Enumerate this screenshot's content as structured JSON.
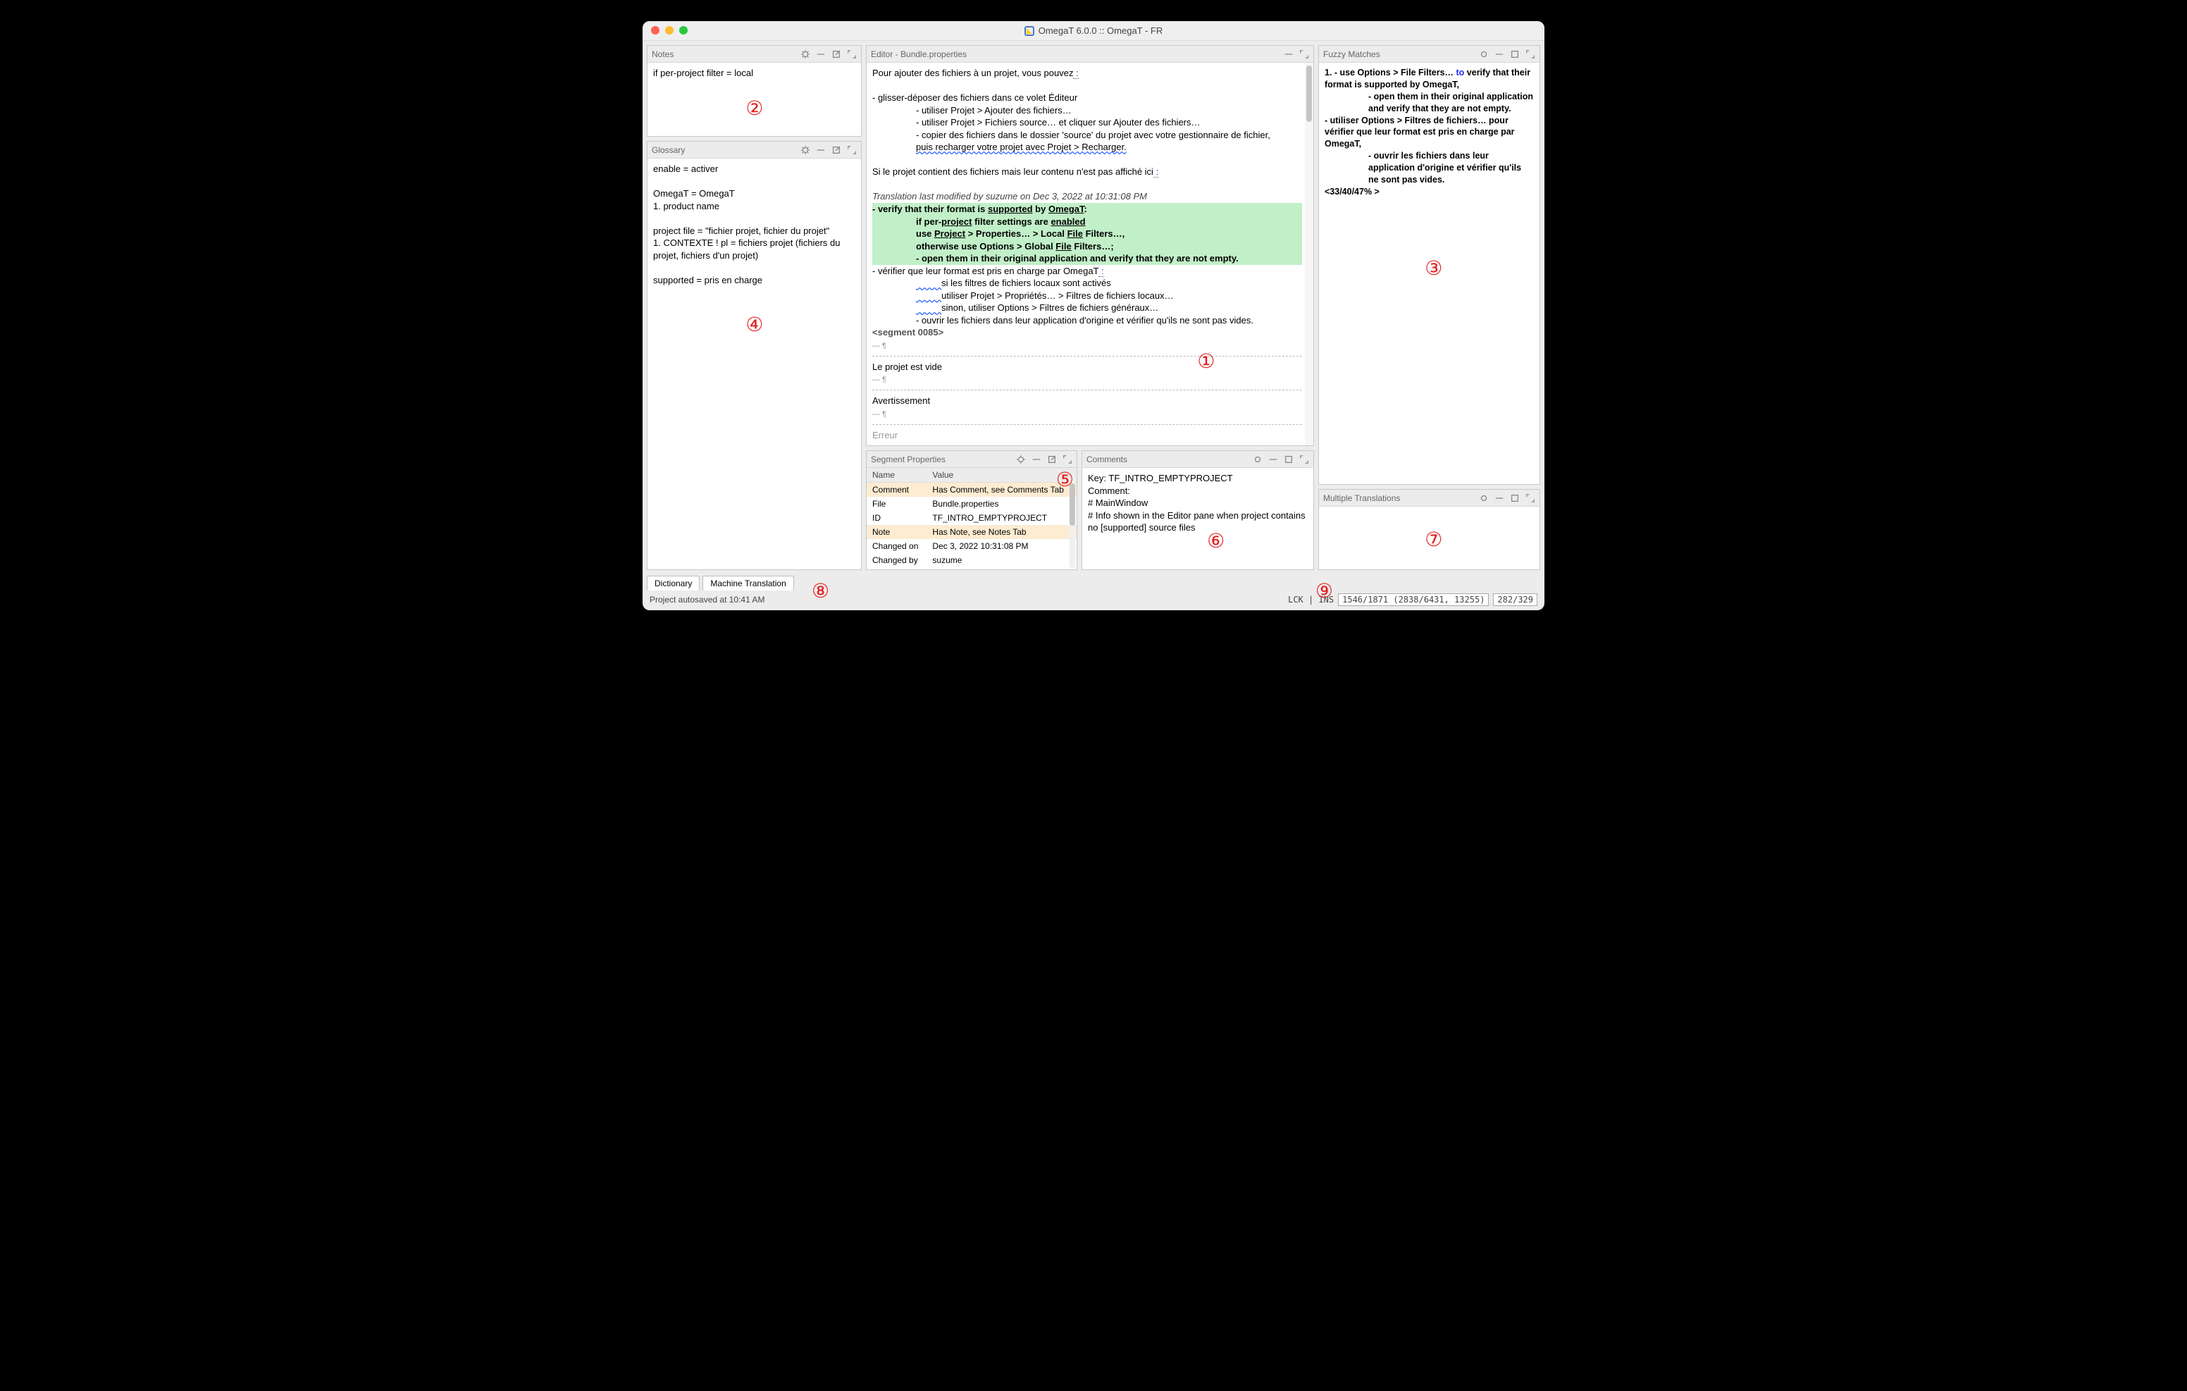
{
  "window": {
    "title": "OmegaT 6.0.0 :: OmegaT - FR"
  },
  "notes": {
    "title": "Notes",
    "text": "if per-project filter = local"
  },
  "glossary": {
    "title": "Glossary",
    "line1": "enable = activer",
    "line2": "OmegaT = OmegaT",
    "line3": "1. product name",
    "line4": "project file = \"fichier projet, fichier du projet\"",
    "line5": "1. CONTEXTE ! pl = fichiers projet (fichiers du projet, fichiers d'un projet)",
    "line6": "supported = pris en charge"
  },
  "editor": {
    "title": "Editor - Bundle.properties",
    "p1": "Pour ajouter des fichiers à un projet, vous pouvez",
    "p1_link": " :",
    "b1": "- glisser-déposer des fichiers dans ce volet Éditeur",
    "b2": "- utiliser Projet > Ajouter des fichiers…",
    "b3": "- utiliser Projet > Fichiers source… et cliquer sur Ajouter des fichiers…",
    "b4": "- copier des fichiers dans le dossier 'source' du projet avec votre gestionnaire de fichier,",
    "b5_pre": "puis recharger votre projet avec Projet > Recharger.",
    "p2": "Si le projet contient des fichiers mais leur contenu n'est pas affiché ici",
    "p2_link": " :",
    "meta": "Translation last modified by suzume on Dec 3, 2022 at 10:31:08 PM",
    "g1_a": "- verify that their format is ",
    "g1_b": "supported",
    "g1_c": " by ",
    "g1_d": "OmegaT",
    "g2_a": "if per-",
    "g2_b": "project",
    "g2_c": " filter settings are ",
    "g2_d": "enabled",
    "g3_a": "use ",
    "g3_b": "Project",
    "g3_c": " > Properties… > Local ",
    "g3_d": "File",
    "g3_e": " Filters…,",
    "g4_a": "otherwise use Options > Global ",
    "g4_b": "File",
    "g4_c": " Filters…;",
    "g5": "- open them in their original application and verify that they are not empty.",
    "f1": "- vérifier que leur format est pris en charge par OmegaT",
    "f1_link": " :",
    "f2": "si les filtres de fichiers locaux sont activés",
    "f3": "utiliser Projet > Propriétés… > Filtres de fichiers locaux…",
    "f4": "sinon, utiliser Options > Filtres de fichiers généraux…",
    "f5": "- ouvrir les fichiers dans leur application d'origine et vérifier qu'ils ne sont pas vides.",
    "segmark": "<segment 0085>",
    "p3": "Le projet est vide",
    "p4": "Avertissement",
    "p5": "Erreur"
  },
  "segprops": {
    "title": "Segment Properties",
    "name": "Name",
    "value": "Value",
    "rows": {
      "r0n": "Comment",
      "r0v": "Has Comment, see Comments Tab",
      "r1n": "File",
      "r1v": "Bundle.properties",
      "r2n": "ID",
      "r2v": "TF_INTRO_EMPTYPROJECT",
      "r3n": "Note",
      "r3v": "Has Note, see Notes Tab",
      "r4n": "Changed on",
      "r4v": "Dec 3, 2022 10:31:08 PM",
      "r5n": "Changed by",
      "r5v": "suzume"
    }
  },
  "comments": {
    "title": "Comments",
    "l1": "Key: TF_INTRO_EMPTYPROJECT",
    "l2": "Comment:",
    "l3": "# MainWindow",
    "l4": "# Info shown in the Editor pane when project contains no [supported] source files"
  },
  "fuzzy": {
    "title": "Fuzzy Matches",
    "l1_a": "1. - use Options > File Filters… ",
    "l1_b": "to",
    "l1_c": " verify that their format is supported by OmegaT,",
    "l2": "- open them in their original application and verify that they are not empty.",
    "l3": "- utiliser Options > Filtres de fichiers… pour vérifier que leur format est pris en charge par OmegaT,",
    "l4": "- ouvrir les fichiers dans leur application d'origine et vérifier qu'ils ne sont pas vides.",
    "l5": "<33/40/47% >"
  },
  "multi": {
    "title": "Multiple Translations"
  },
  "footer": {
    "tab1": "Dictionary",
    "tab2": "Machine Translation",
    "autosave": "Project autosaved at 10:41 AM",
    "lockins": "LCK | INS",
    "stat1": "1546/1871 (2838/6431, 13255)",
    "stat2": "282/329"
  },
  "badges": {
    "b1": "①",
    "b2": "②",
    "b3": "③",
    "b4": "④",
    "b5": "⑤",
    "b6": "⑥",
    "b7": "⑦",
    "b8": "⑧",
    "b9": "⑨"
  }
}
